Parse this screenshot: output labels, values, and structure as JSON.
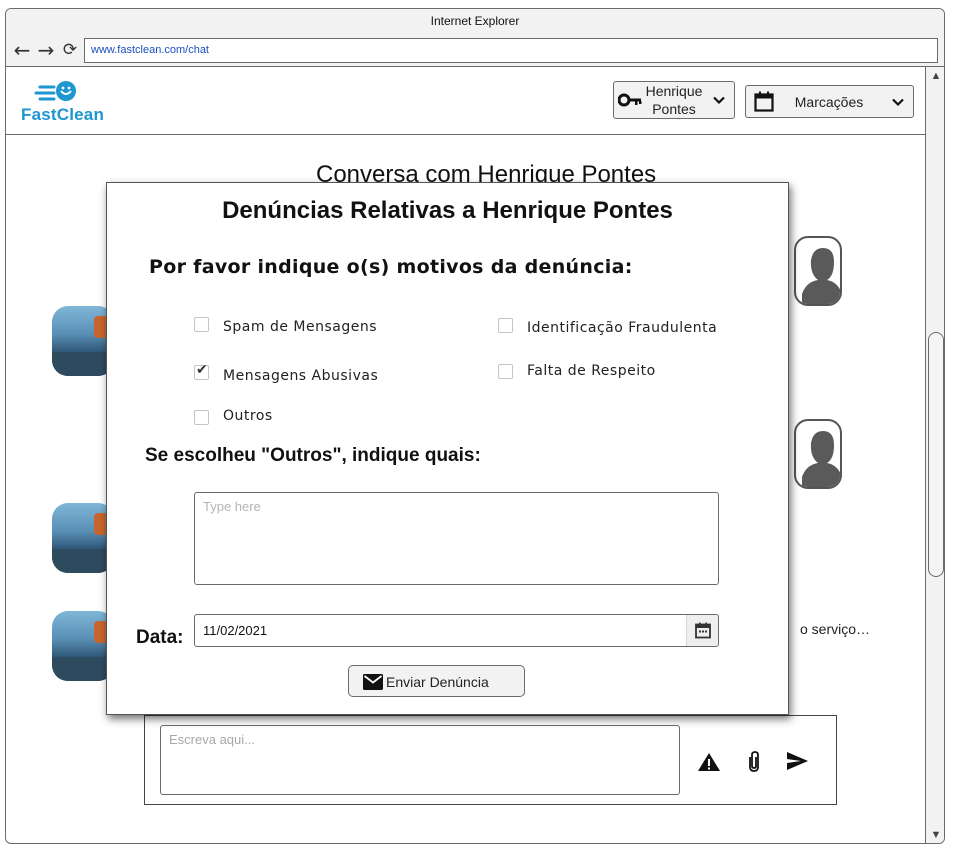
{
  "browser": {
    "title": "Internet Explorer",
    "url": "www.fastclean.com/chat",
    "back_icon": "arrow-left-icon",
    "forward_icon": "arrow-right-icon",
    "refresh_icon": "refresh-icon"
  },
  "header": {
    "logo_text": "FastClean",
    "brand_color": "#1e96d0",
    "account": {
      "name_line1": "Henrique",
      "name_line2": "Pontes",
      "icon": "key-icon"
    },
    "bookings": {
      "label": "Marcações",
      "icon": "calendar-icon"
    }
  },
  "chat": {
    "title": "Conversa com Henrique Pontes",
    "partial_message": "o serviço…"
  },
  "composer": {
    "placeholder": "Escreva aqui...",
    "icons": [
      "warning-icon",
      "paperclip-icon",
      "send-icon"
    ]
  },
  "modal": {
    "title": "Denúncias Relativas a Henrique Pontes",
    "question": "Por favor indique o(s) motivos da denúncia:",
    "options": [
      {
        "label": "Spam de Mensagens",
        "checked": false
      },
      {
        "label": "Identificação Fraudulenta",
        "checked": false
      },
      {
        "label": "Mensagens Abusivas",
        "checked": true
      },
      {
        "label": "Falta de Respeito",
        "checked": false
      },
      {
        "label": "Outros",
        "checked": false
      }
    ],
    "others_question": "Se escolheu \"Outros\", indique quais:",
    "others_placeholder": "Type here",
    "date_label": "Data:",
    "date_value": "11/02/2021",
    "submit_label": "Enviar Denúncia"
  }
}
